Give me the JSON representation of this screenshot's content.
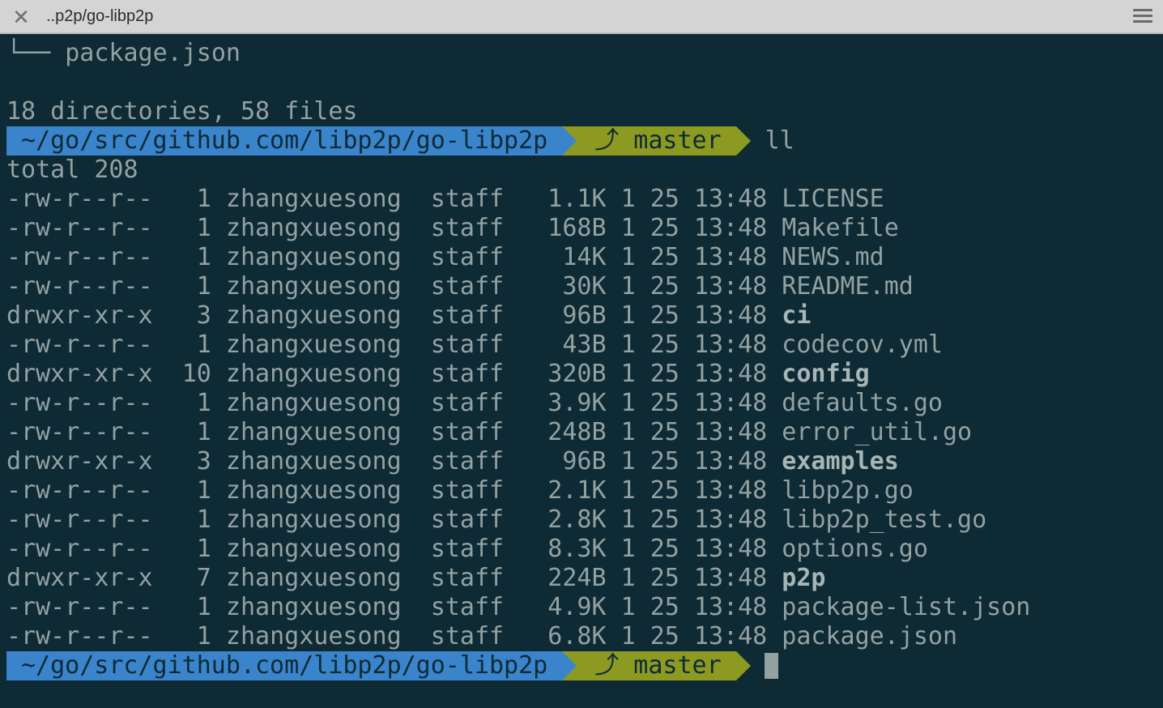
{
  "window": {
    "title": "..p2p/go-libp2p"
  },
  "terminal": {
    "tree_last": "└── package.json",
    "summary": "18 directories, 58 files",
    "prompt": {
      "path": "~/go/src/github.com/libp2p/go-libp2p",
      "git_icon": "branch-icon",
      "branch": "⤴ master"
    },
    "command": "ll",
    "total": "total 208",
    "listing": [
      {
        "perms": "-rw-r--r--",
        "links": "1",
        "owner": "zhangxuesong",
        "group": "staff",
        "size": "1.1K",
        "date": "1 25 13:48",
        "name": "LICENSE",
        "dir": false
      },
      {
        "perms": "-rw-r--r--",
        "links": "1",
        "owner": "zhangxuesong",
        "group": "staff",
        "size": "168B",
        "date": "1 25 13:48",
        "name": "Makefile",
        "dir": false
      },
      {
        "perms": "-rw-r--r--",
        "links": "1",
        "owner": "zhangxuesong",
        "group": "staff",
        "size": "14K",
        "date": "1 25 13:48",
        "name": "NEWS.md",
        "dir": false
      },
      {
        "perms": "-rw-r--r--",
        "links": "1",
        "owner": "zhangxuesong",
        "group": "staff",
        "size": "30K",
        "date": "1 25 13:48",
        "name": "README.md",
        "dir": false
      },
      {
        "perms": "drwxr-xr-x",
        "links": "3",
        "owner": "zhangxuesong",
        "group": "staff",
        "size": "96B",
        "date": "1 25 13:48",
        "name": "ci",
        "dir": true
      },
      {
        "perms": "-rw-r--r--",
        "links": "1",
        "owner": "zhangxuesong",
        "group": "staff",
        "size": "43B",
        "date": "1 25 13:48",
        "name": "codecov.yml",
        "dir": false
      },
      {
        "perms": "drwxr-xr-x",
        "links": "10",
        "owner": "zhangxuesong",
        "group": "staff",
        "size": "320B",
        "date": "1 25 13:48",
        "name": "config",
        "dir": true
      },
      {
        "perms": "-rw-r--r--",
        "links": "1",
        "owner": "zhangxuesong",
        "group": "staff",
        "size": "3.9K",
        "date": "1 25 13:48",
        "name": "defaults.go",
        "dir": false
      },
      {
        "perms": "-rw-r--r--",
        "links": "1",
        "owner": "zhangxuesong",
        "group": "staff",
        "size": "248B",
        "date": "1 25 13:48",
        "name": "error_util.go",
        "dir": false
      },
      {
        "perms": "drwxr-xr-x",
        "links": "3",
        "owner": "zhangxuesong",
        "group": "staff",
        "size": "96B",
        "date": "1 25 13:48",
        "name": "examples",
        "dir": true
      },
      {
        "perms": "-rw-r--r--",
        "links": "1",
        "owner": "zhangxuesong",
        "group": "staff",
        "size": "2.1K",
        "date": "1 25 13:48",
        "name": "libp2p.go",
        "dir": false
      },
      {
        "perms": "-rw-r--r--",
        "links": "1",
        "owner": "zhangxuesong",
        "group": "staff",
        "size": "2.8K",
        "date": "1 25 13:48",
        "name": "libp2p_test.go",
        "dir": false
      },
      {
        "perms": "-rw-r--r--",
        "links": "1",
        "owner": "zhangxuesong",
        "group": "staff",
        "size": "8.3K",
        "date": "1 25 13:48",
        "name": "options.go",
        "dir": false
      },
      {
        "perms": "drwxr-xr-x",
        "links": "7",
        "owner": "zhangxuesong",
        "group": "staff",
        "size": "224B",
        "date": "1 25 13:48",
        "name": "p2p",
        "dir": true
      },
      {
        "perms": "-rw-r--r--",
        "links": "1",
        "owner": "zhangxuesong",
        "group": "staff",
        "size": "4.9K",
        "date": "1 25 13:48",
        "name": "package-list.json",
        "dir": false
      },
      {
        "perms": "-rw-r--r--",
        "links": "1",
        "owner": "zhangxuesong",
        "group": "staff",
        "size": "6.8K",
        "date": "1 25 13:48",
        "name": "package.json",
        "dir": false
      }
    ],
    "colors": {
      "background": "#0e2a35",
      "foreground": "#93a1a1",
      "path_segment": "#3a84cc",
      "git_segment": "#8d9a21"
    }
  }
}
